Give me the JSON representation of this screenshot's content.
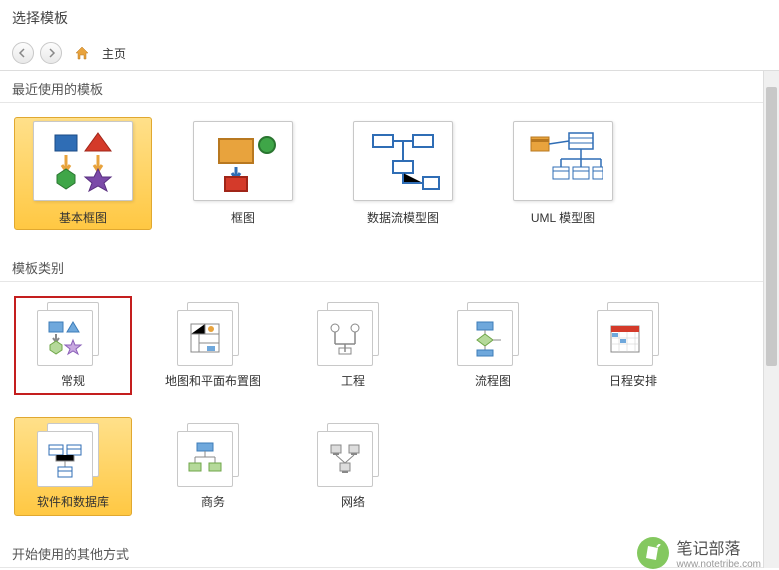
{
  "header": {
    "title": "选择模板"
  },
  "nav": {
    "home_label": "主页"
  },
  "sections": {
    "recent_label": "最近使用的模板",
    "categories_label": "模板类别",
    "start_label": "开始使用的其他方式"
  },
  "recent_templates": [
    {
      "label": "基本框图",
      "selected": true
    },
    {
      "label": "框图",
      "selected": false
    },
    {
      "label": "数据流模型图",
      "selected": false
    },
    {
      "label": "UML 模型图",
      "selected": false
    }
  ],
  "categories": [
    {
      "label": "常规",
      "selected": false,
      "highlighted": true
    },
    {
      "label": "地图和平面布置图",
      "selected": false,
      "highlighted": false
    },
    {
      "label": "工程",
      "selected": false,
      "highlighted": false
    },
    {
      "label": "流程图",
      "selected": false,
      "highlighted": false
    },
    {
      "label": "日程安排",
      "selected": false,
      "highlighted": false
    },
    {
      "label": "软件和数据库",
      "selected": true,
      "highlighted": false
    },
    {
      "label": "商务",
      "selected": false,
      "highlighted": false
    },
    {
      "label": "网络",
      "selected": false,
      "highlighted": false
    }
  ],
  "watermark": {
    "title": "笔记部落",
    "url": "www.notetribe.com"
  }
}
